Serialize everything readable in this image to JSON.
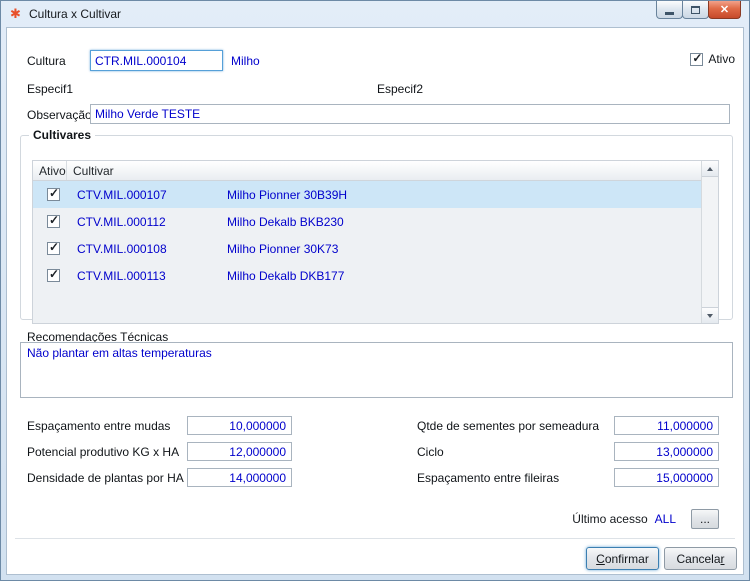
{
  "colors": {
    "accent_blue": "#0000CC",
    "selection_bg": "#CDE6F7",
    "close_red": "#C64A2A"
  },
  "window": {
    "title": "Cultura x Cultivar"
  },
  "form": {
    "cultura": {
      "label": "Cultura",
      "value": "CTR.MIL.000104",
      "description": "Milho"
    },
    "ativo": {
      "label": "Ativo",
      "checked": true
    },
    "especif1_label": "Especif1",
    "especif2_label": "Especif2",
    "observacao": {
      "label": "Observação",
      "value": "Milho Verde TESTE"
    }
  },
  "cultivares": {
    "legend": "Cultivares",
    "columns": [
      "Ativo",
      "Cultivar"
    ],
    "rows": [
      {
        "ativo": true,
        "code": "CTV.MIL.000107",
        "name": "Milho Pionner 30B39H",
        "selected": true
      },
      {
        "ativo": true,
        "code": "CTV.MIL.000112",
        "name": "Milho Dekalb BKB230",
        "selected": false
      },
      {
        "ativo": true,
        "code": "CTV.MIL.000108",
        "name": "Milho Pionner 30K73",
        "selected": false
      },
      {
        "ativo": true,
        "code": "CTV.MIL.000113",
        "name": "Milho Dekalb DKB177",
        "selected": false
      }
    ]
  },
  "recomendacoes": {
    "label": "Recomendações Técnicas",
    "value": "Não plantar em altas temperaturas"
  },
  "metrics": {
    "left": [
      {
        "label": "Espaçamento entre mudas",
        "value": "10,000000"
      },
      {
        "label": "Potencial produtivo KG x HA",
        "value": "12,000000"
      },
      {
        "label": "Densidade de plantas por HA",
        "value": "14,000000"
      }
    ],
    "right": [
      {
        "label": "Qtde de sementes por semeadura",
        "value": "11,000000"
      },
      {
        "label": "Ciclo",
        "value": "13,000000"
      },
      {
        "label": "Espaçamento entre fileiras",
        "value": "15,000000"
      }
    ]
  },
  "footer": {
    "ultimo_acesso": {
      "label": "Último acesso",
      "value": "ALL"
    },
    "browse_button": "...",
    "buttons": {
      "confirm": {
        "pre": "",
        "key": "C",
        "post": "onfirmar"
      },
      "cancel": {
        "pre": "Cancela",
        "key": "r",
        "post": ""
      }
    }
  }
}
